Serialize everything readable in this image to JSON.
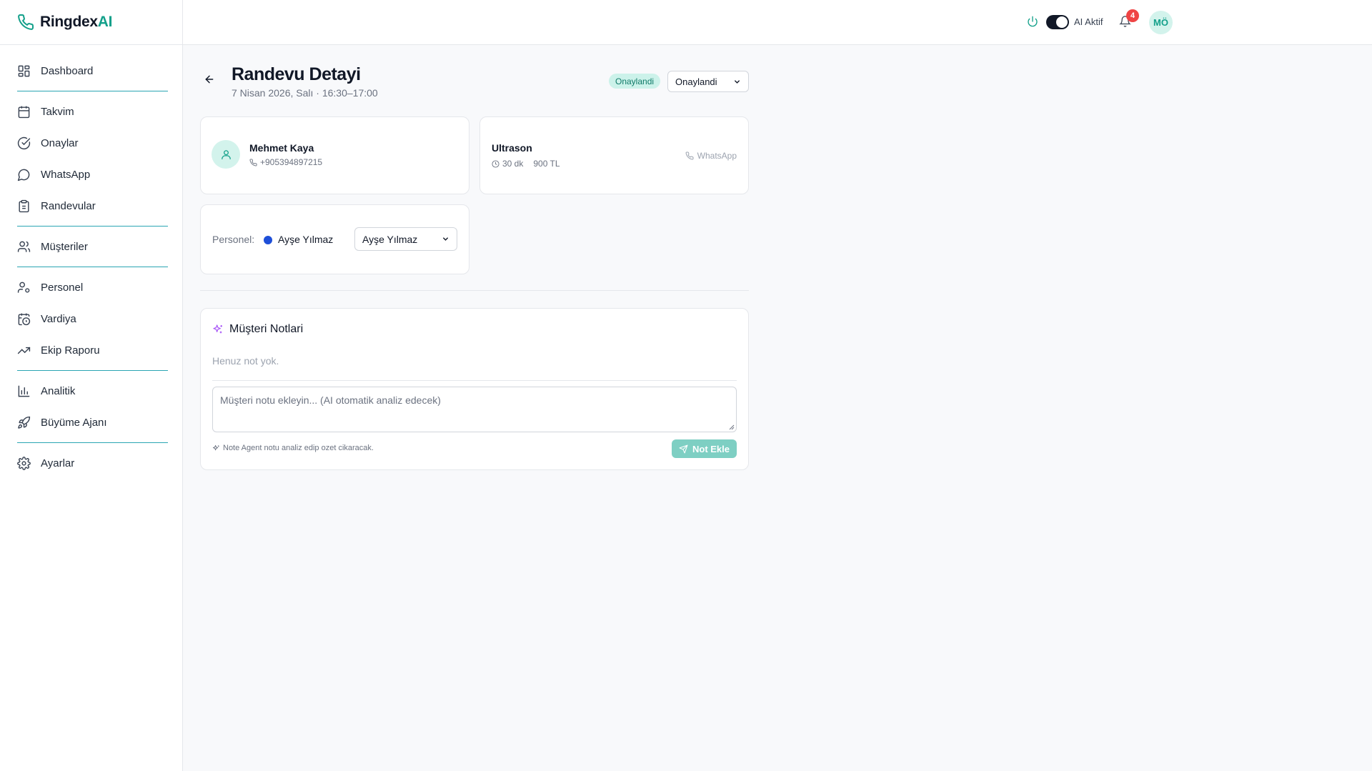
{
  "brand": {
    "name_main": "Ringdex",
    "name_accent": "AI"
  },
  "sidebar": {
    "items": [
      {
        "label": "Dashboard",
        "icon": "grid-icon"
      },
      {
        "label": "Takvim",
        "icon": "calendar-icon"
      },
      {
        "label": "Onaylar",
        "icon": "check-circle-icon"
      },
      {
        "label": "WhatsApp",
        "icon": "chat-bubble-icon"
      },
      {
        "label": "Randevular",
        "icon": "clipboard-icon"
      },
      {
        "label": "Müşteriler",
        "icon": "users-icon"
      },
      {
        "label": "Personel",
        "icon": "user-cog-icon"
      },
      {
        "label": "Vardiya",
        "icon": "calendar-clock-icon"
      },
      {
        "label": "Ekip Raporu",
        "icon": "trending-up-icon"
      },
      {
        "label": "Analitik",
        "icon": "bar-chart-icon"
      },
      {
        "label": "Büyüme Ajanı",
        "icon": "rocket-icon"
      },
      {
        "label": "Ayarlar",
        "icon": "gear-icon"
      }
    ]
  },
  "topbar": {
    "ai_label": "AI Aktif",
    "ai_enabled": true,
    "notification_count": "4",
    "avatar_initials": "MÖ"
  },
  "page": {
    "title": "Randevu Detayi",
    "subtitle": "7 Nisan 2026, Salı · 16:30–17:00",
    "status_badge": "Onaylandi",
    "status_select": "Onaylandi"
  },
  "customer": {
    "name": "Mehmet Kaya",
    "phone": "+905394897215"
  },
  "service": {
    "name": "Ultrason",
    "duration": "30 dk",
    "price": "900 TL",
    "channel": "WhatsApp"
  },
  "staff": {
    "label": "Personel:",
    "name": "Ayşe Yılmaz",
    "select_value": "Ayşe Yılmaz",
    "color": "#1e4fd8"
  },
  "notes": {
    "title": "Müşteri Notlari",
    "empty_text": "Henuz not yok.",
    "placeholder": "Müşteri notu ekleyin... (AI otomatik analiz edecek)",
    "hint": "Note Agent notu analiz edip ozet cikaracak.",
    "button_label": "Not Ekle"
  },
  "colors": {
    "accent": "#13a08a",
    "separator": "#2aa5b3",
    "badge_bg": "#ccf2ea",
    "button_bg": "#7ecfc3"
  }
}
